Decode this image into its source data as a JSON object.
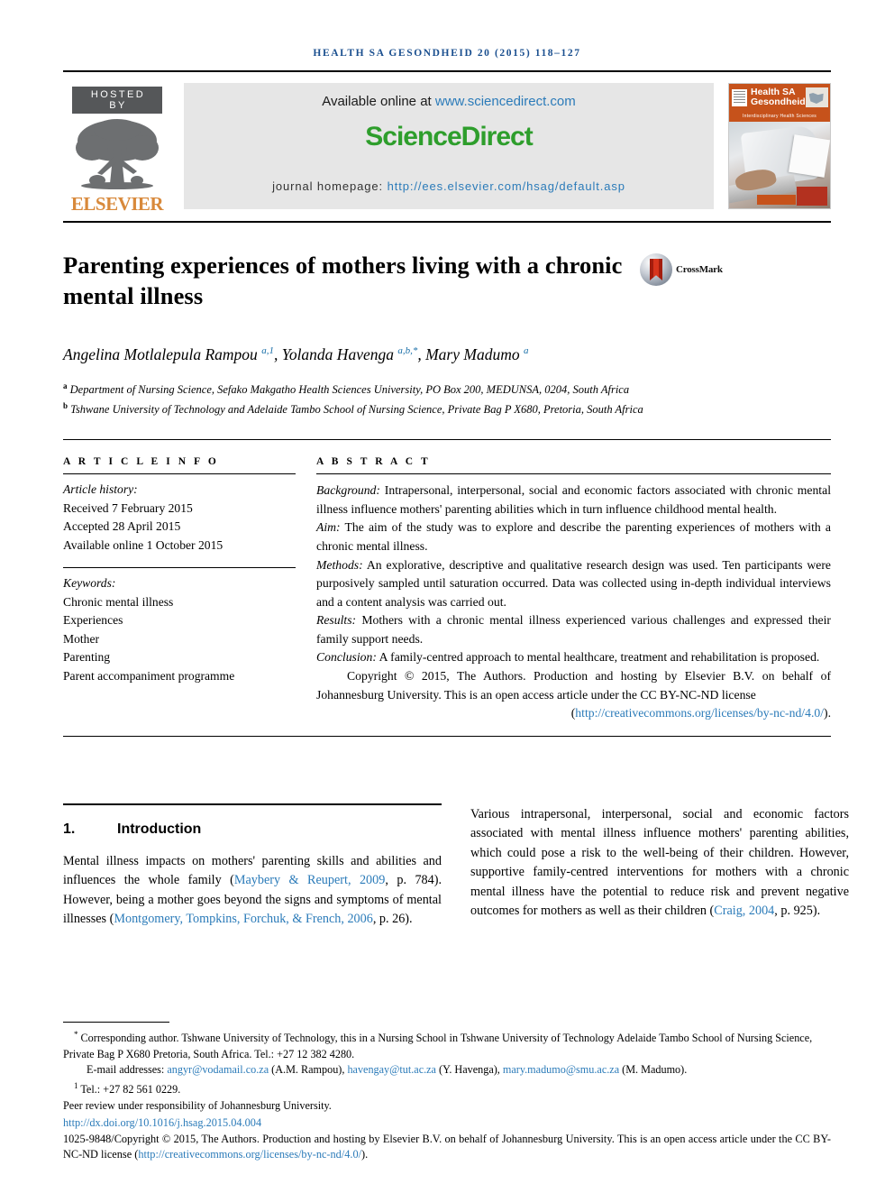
{
  "running_head": "HEALTH SA GESONDHEID 20 (2015) 118–127",
  "masthead": {
    "hosted_by": "HOSTED BY",
    "publisher": "ELSEVIER",
    "available_online_prefix": "Available online at ",
    "sciencedirect_url": "www.sciencedirect.com",
    "sciencedirect_logo": "ScienceDirect",
    "journal_homepage_label": "journal homepage: ",
    "journal_homepage_url": "http://ees.elsevier.com/hsag/default.asp",
    "cover": {
      "title_line1": "Health SA",
      "title_line2": "Gesondheid",
      "strip_text": "Interdisciplinary Health Sciences"
    }
  },
  "article": {
    "title": "Parenting experiences of mothers living with a chronic mental illness",
    "crossmark_label": "CrossMark",
    "authors_html": "Angelina Motlalepula Rampou <sup>a,1</sup>, Yolanda Havenga <sup>a,b,*</sup>, Mary Madumo <sup>a</sup>",
    "affiliations": [
      {
        "marker": "a",
        "text": "Department of Nursing Science, Sefako Makgatho Health Sciences University, PO Box 200, MEDUNSA, 0204, South Africa"
      },
      {
        "marker": "b",
        "text": "Tshwane University of Technology and Adelaide Tambo School of Nursing Science, Private Bag P X680, Pretoria, South Africa"
      }
    ]
  },
  "article_info": {
    "heading": "A R T I C L E   I N F O",
    "history_label": "Article history:",
    "history": [
      "Received 7 February 2015",
      "Accepted 28 April 2015",
      "Available online 1 October 2015"
    ],
    "keywords_label": "Keywords:",
    "keywords": [
      "Chronic mental illness",
      "Experiences",
      "Mother",
      "Parenting",
      "Parent accompaniment programme"
    ]
  },
  "abstract": {
    "heading": "A B S T R A C T",
    "sections": [
      {
        "label": "Background:",
        "text": " Intrapersonal, interpersonal, social and economic factors associated with chronic mental illness influence mothers' parenting abilities which in turn influence childhood mental health."
      },
      {
        "label": "Aim:",
        "text": " The aim of the study was to explore and describe the parenting experiences of mothers with a chronic mental illness."
      },
      {
        "label": "Methods:",
        "text": " An explorative, descriptive and qualitative research design was used. Ten participants were purposively sampled until saturation occurred. Data was collected using in-depth individual interviews and a content analysis was carried out."
      },
      {
        "label": "Results:",
        "text": " Mothers with a chronic mental illness experienced various challenges and expressed their family support needs."
      },
      {
        "label": "Conclusion:",
        "text": " A family-centred approach to mental healthcare, treatment and rehabilitation is proposed."
      }
    ],
    "copyright_text": "Copyright © 2015, The Authors. Production and hosting by Elsevier B.V. on behalf of Johannesburg University. This is an open access article under the CC BY-NC-ND license",
    "license_open_paren": "(",
    "license_url": "http://creativecommons.org/licenses/by-nc-nd/4.0/",
    "license_close_paren": ")."
  },
  "body": {
    "section_number": "1.",
    "section_title": "Introduction",
    "left_paragraph_parts": [
      {
        "type": "text",
        "value": "Mental illness impacts on mothers' parenting skills and abilities and influences the whole family ("
      },
      {
        "type": "link",
        "value": "Maybery & Reupert, 2009"
      },
      {
        "type": "text",
        "value": ", p. 784). However, being a mother goes beyond the signs and symptoms of mental illnesses ("
      },
      {
        "type": "link",
        "value": "Montgomery, Tompkins, Forchuk, & French, 2006"
      },
      {
        "type": "text",
        "value": ", p. 26)."
      }
    ],
    "right_paragraph_parts": [
      {
        "type": "text",
        "value": "Various intrapersonal, interpersonal, social and economic factors associated with mental illness influence mothers' parenting abilities, which could pose a risk to the well-being of their children. However, supportive family-centred interventions for mothers with a chronic mental illness have the potential to reduce risk and prevent negative outcomes for mothers as well as their children ("
      },
      {
        "type": "link",
        "value": "Craig, 2004"
      },
      {
        "type": "text",
        "value": ", p. 925)."
      }
    ]
  },
  "footnotes": {
    "corresponding": "Corresponding author. Tshwane University of Technology, this in a Nursing School in Tshwane University of Technology Adelaide Tambo School of Nursing Science, Private Bag P X680 Pretoria, South Africa. Tel.: +27 12 382 4280.",
    "email_label": "E-mail addresses: ",
    "emails": [
      {
        "address": "angyr@vodamail.co.za",
        "owner": " (A.M. Rampou), "
      },
      {
        "address": "havengay@tut.ac.za",
        "owner": " (Y. Havenga), "
      },
      {
        "address": "mary.madumo@smu.ac.za",
        "owner": " (M. Madumo)."
      }
    ],
    "tel_note": "Tel.: +27 82 561 0229.",
    "peer_review": "Peer review under responsibility of Johannesburg University.",
    "doi_url": "http://dx.doi.org/10.1016/j.hsag.2015.04.004",
    "issn_copyright": "1025-9848/Copyright © 2015, The Authors. Production and hosting by Elsevier B.V. on behalf of Johannesburg University. This is an open access article under the CC BY-NC-ND license (",
    "issn_license_url": "http://creativecommons.org/licenses/by-nc-nd/4.0/",
    "issn_license_tail": ")."
  },
  "colors": {
    "link": "#2b7bb9",
    "running_head": "#1a4f8f",
    "sciencedirect_green": "#2e9e2c",
    "elsevier_orange": "#d8893b",
    "cover_orange": "#c6521b"
  }
}
